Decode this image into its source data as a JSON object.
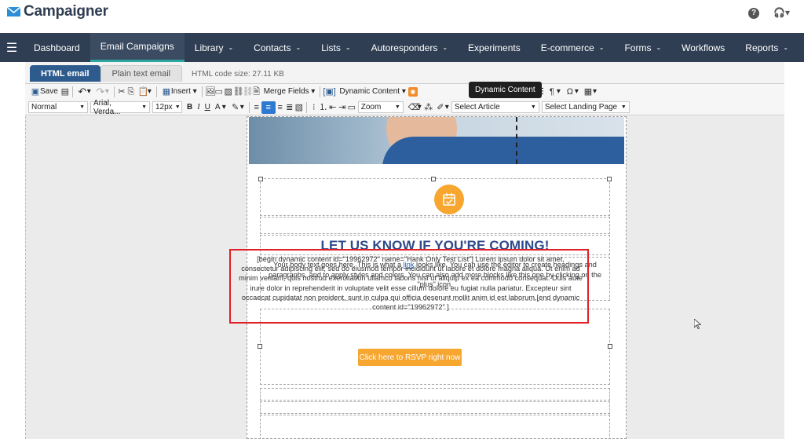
{
  "app": {
    "brand": "Campaigner"
  },
  "nav": {
    "items": [
      {
        "label": "Dashboard",
        "caret": false,
        "active": false
      },
      {
        "label": "Email Campaigns",
        "caret": false,
        "active": true
      },
      {
        "label": "Library",
        "caret": true,
        "active": false
      },
      {
        "label": "Contacts",
        "caret": true,
        "active": false
      },
      {
        "label": "Lists",
        "caret": true,
        "active": false
      },
      {
        "label": "Autoresponders",
        "caret": true,
        "active": false
      },
      {
        "label": "Experiments",
        "caret": false,
        "active": false
      },
      {
        "label": "E-commerce",
        "caret": true,
        "active": false
      },
      {
        "label": "Forms",
        "caret": true,
        "active": false
      },
      {
        "label": "Workflows",
        "caret": false,
        "active": false
      },
      {
        "label": "Reports",
        "caret": true,
        "active": false
      }
    ]
  },
  "editor": {
    "tab_html": "HTML email",
    "tab_plain": "Plain text email",
    "code_size": "HTML code size: 27.11 KB",
    "toolbar1": {
      "save": "Save",
      "insert": "Insert",
      "merge_fields": "Merge Fields",
      "dynamic_content": "Dynamic Content"
    },
    "tooltip": "Dynamic Content",
    "toolbar2": {
      "format": "Normal",
      "font": "Arial, Verda...",
      "size": "12px",
      "zoom": "Zoom",
      "article": "Select Article",
      "landing_page": "Select Landing Page"
    }
  },
  "email": {
    "headline": "LET US KNOW IF YOU'RE COMING!",
    "body_pre": "Your body text goes here. This is what a ",
    "body_link": "link",
    "body_post": " looks like. You can use the editor to create headings and paragraphs, and to apply styles and colors. You can also add more blocks like this one by clicking on the \"plus\" icon.",
    "dynamic_text": "[begin dynamic content id=\"19962972\" name=\"Hank Only Test List\"] Lorem ipsum dolor sit amet, consectetur adipiscing elit, sed do eiusmod tempor incididunt ut labore et dolore magna aliqua. Ut enim ad minim veniam, quis nostrud exercitation ullamco laboris nisi ut aliquip ex ea commodo consequat. Duis aute irure dolor in reprehenderit in voluptate velit esse cillum dolore eu fugiat nulla pariatur. Excepteur sint occaecat cupidatat non proident, sunt in culpa qui officia deserunt mollit anim id est laborum.[end dynamic content id=\"19962972\" ]",
    "rsvp_button": "Click here to RSVP right now"
  },
  "colors": {
    "nav_bg": "#2f3e53",
    "headline": "#2e4a8a",
    "accent_orange": "#f7a630",
    "highlight_red": "#e01f26"
  },
  "icons": [
    "envelope-logo-icon",
    "help-icon",
    "headset-icon",
    "hamburger-icon",
    "calendar-check-icon",
    "mouse-cursor-icon"
  ]
}
